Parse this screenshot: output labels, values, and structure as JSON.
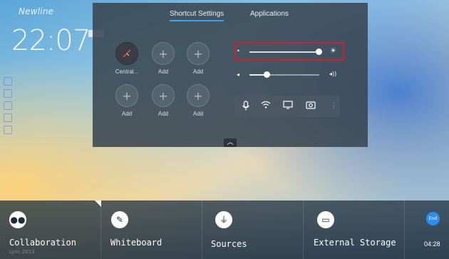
{
  "desktop": {
    "logo": "Newline",
    "time": "22:07"
  },
  "panel": {
    "tabs": [
      {
        "label": "Shortcut Settings",
        "active": true
      },
      {
        "label": "Applications",
        "active": false
      }
    ],
    "shortcuts": [
      {
        "label": "Central...",
        "icon": "clock-icon"
      },
      {
        "label": "Add",
        "icon": "plus-icon"
      },
      {
        "label": "Add",
        "icon": "plus-icon"
      },
      {
        "label": "Add",
        "icon": "plus-icon"
      },
      {
        "label": "Add",
        "icon": "plus-icon"
      },
      {
        "label": "Add",
        "icon": "plus-icon"
      }
    ],
    "brightness": {
      "level": 0.9,
      "highlight_color": "#d11f2b"
    },
    "volume": {
      "level": 0.35
    },
    "toggles": [
      "microphone-icon",
      "wifi-icon",
      "screen-cast-icon",
      "screenshot-icon",
      "more-icon"
    ]
  },
  "taskbar": {
    "items": [
      {
        "label": "Collaboration",
        "sub": "Lync 2013",
        "icon": "collaboration-icon"
      },
      {
        "label": "Whiteboard",
        "icon": "whiteboard-icon"
      },
      {
        "label": "Sources",
        "icon": "sources-icon"
      },
      {
        "label": "External Storage",
        "icon": "storage-icon"
      }
    ],
    "end_label": "End",
    "timer": "04:28"
  },
  "colors": {
    "accent": "#3ea2ef",
    "end_button": "#2c8ef4"
  }
}
